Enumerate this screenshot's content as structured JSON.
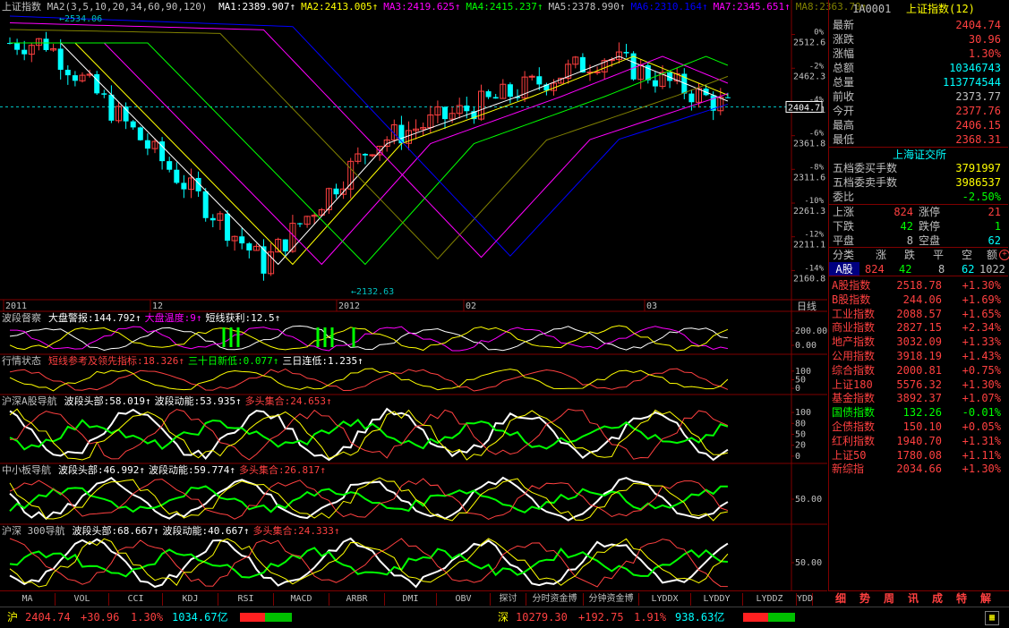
{
  "main_chart": {
    "index_name": "上证指数",
    "ma_header": "MA2(3,5,10,20,34,60,90,120)",
    "ma": [
      {
        "label": "MA1:2389.907",
        "color": "#ffffff"
      },
      {
        "label": "MA2:2413.005",
        "color": "#ffff00"
      },
      {
        "label": "MA3:2419.625",
        "color": "#ff00ff"
      },
      {
        "label": "MA4:2415.237",
        "color": "#00ff00"
      },
      {
        "label": "MA5:2378.990",
        "color": "#c0c0c0"
      },
      {
        "label": "MA6:2310.164",
        "color": "#0000ff"
      },
      {
        "label": "MA7:2345.651",
        "color": "#ff00ff"
      },
      {
        "label": "MA8:2363.70",
        "color": "#808000"
      }
    ],
    "high_label": "2534.06",
    "low_label": "2132.63",
    "current_price_tag": "2404.7",
    "price_ticks": [
      "2512.6",
      "2462.3",
      "2412.1",
      "2361.8",
      "2311.6",
      "2261.3",
      "2211.1",
      "2160.8"
    ],
    "pct_ticks": [
      "0%",
      "-2%",
      "-4%",
      "-6%",
      "-8%",
      "-10%",
      "-12%",
      "-14%"
    ],
    "date_labels": [
      "2011",
      "12",
      "2012",
      "02",
      "03"
    ],
    "period": "日线"
  },
  "panels": [
    {
      "title": "波段督察",
      "items": [
        {
          "t": "大盘警报:144.792",
          "c": "#ffffff"
        },
        {
          "t": "大盘温度:9",
          "c": "#ff00ff"
        },
        {
          "t": "短线获利:12.5",
          "c": "#ffffff"
        }
      ],
      "ticks": [
        "200.00",
        "0.00"
      ]
    },
    {
      "title": "行情状态",
      "items": [
        {
          "t": "短线参考及领先指标:18.326",
          "c": "#ff4040"
        },
        {
          "t": "三十日新低:0.077",
          "c": "#00ff00"
        },
        {
          "t": "三日连低:1.235",
          "c": "#ffffff"
        }
      ],
      "ticks": [
        "100",
        "50",
        "0"
      ]
    },
    {
      "title": "沪深A股导航",
      "items": [
        {
          "t": "波段头部:58.019",
          "c": "#ffffff"
        },
        {
          "t": "波段动能:53.935",
          "c": "#ffffff"
        },
        {
          "t": "多头集合:24.653",
          "c": "#ff4040"
        }
      ],
      "ticks": [
        "100",
        "80",
        "50",
        "20",
        "0"
      ]
    },
    {
      "title": "中小板导航",
      "items": [
        {
          "t": "波段头部:46.992",
          "c": "#ffffff"
        },
        {
          "t": "波段动能:59.774",
          "c": "#ffffff"
        },
        {
          "t": "多头集合:26.817",
          "c": "#ff4040"
        }
      ],
      "ticks": [
        "50.00"
      ]
    },
    {
      "title": "沪深 300导航",
      "items": [
        {
          "t": "波段头部:68.667",
          "c": "#ffffff"
        },
        {
          "t": "波段动能:40.667",
          "c": "#ffffff"
        },
        {
          "t": "多头集合:24.333",
          "c": "#ff4040"
        }
      ],
      "ticks": [
        "50.00"
      ]
    }
  ],
  "quote": {
    "code": "1A0001",
    "name": "上证指数(12)",
    "rows": [
      {
        "k": "最新",
        "v": "2404.74",
        "c": "#ff4040"
      },
      {
        "k": "涨跌",
        "v": "30.96",
        "c": "#ff4040"
      },
      {
        "k": "涨幅",
        "v": "1.30%",
        "c": "#ff4040"
      },
      {
        "k": "总额",
        "v": "10346743",
        "c": "#00ffff"
      },
      {
        "k": "总量",
        "v": "113774544",
        "c": "#00ffff"
      },
      {
        "k": "前收",
        "v": "2373.77",
        "c": "#c0c0c0"
      },
      {
        "k": "今开",
        "v": "2377.76",
        "c": "#ff4040"
      },
      {
        "k": "最高",
        "v": "2406.15",
        "c": "#ff4040"
      },
      {
        "k": "最低",
        "v": "2368.31",
        "c": "#ff4040"
      }
    ],
    "exchange": "上海证交所",
    "rows2": [
      {
        "k": "五档委买手数",
        "v": "3791997",
        "c": "#ffff00"
      },
      {
        "k": "五档委卖手数",
        "v": "3986537",
        "c": "#ffff00"
      },
      {
        "k": "委比",
        "v": "-2.50%",
        "c": "#00ff00"
      }
    ],
    "breadth": {
      "up_k": "上涨",
      "up_v": "824",
      "limit_up_k": "涨停",
      "limit_up_v": "21",
      "down_k": "下跌",
      "down_v": "42",
      "limit_down_k": "跌停",
      "limit_down_v": "1",
      "flat_k": "平盘",
      "flat_v": "8",
      "empty_k": "空盘",
      "empty_v": "62"
    },
    "class_header": [
      "分类",
      "涨",
      "跌",
      "平",
      "空",
      "额"
    ],
    "class_row": {
      "name": "A股",
      "up": "824",
      "down": "42",
      "flat": "8",
      "empty": "62",
      "amt": "1022"
    }
  },
  "indices": [
    {
      "n": "A股指数",
      "p": "2518.78",
      "c": "+1.30%"
    },
    {
      "n": "B股指数",
      "p": "244.06",
      "c": "+1.69%"
    },
    {
      "n": "工业指数",
      "p": "2088.57",
      "c": "+1.65%"
    },
    {
      "n": "商业指数",
      "p": "2827.15",
      "c": "+2.34%"
    },
    {
      "n": "地产指数",
      "p": "3032.09",
      "c": "+1.33%"
    },
    {
      "n": "公用指数",
      "p": "3918.19",
      "c": "+1.43%"
    },
    {
      "n": "综合指数",
      "p": "2000.81",
      "c": "+0.75%"
    },
    {
      "n": "上证180",
      "p": "5576.32",
      "c": "+1.30%"
    },
    {
      "n": "基金指数",
      "p": "3892.37",
      "c": "+1.07%"
    },
    {
      "n": "国债指数",
      "p": "132.26",
      "c": "-0.01%",
      "green": true
    },
    {
      "n": "企债指数",
      "p": "150.10",
      "c": "+0.05%"
    },
    {
      "n": "红利指数",
      "p": "1940.70",
      "c": "+1.31%"
    },
    {
      "n": "上证50",
      "p": "1780.08",
      "c": "+1.11%"
    },
    {
      "n": "新综指",
      "p": "2034.66",
      "c": "+1.30%"
    }
  ],
  "tabs": [
    "MA",
    "VOL",
    "CCI",
    "KDJ",
    "RSI",
    "MACD",
    "ARBR",
    "DMI",
    "OBV",
    "探讨",
    "分时资金博",
    "分钟资金博",
    "LYDDX",
    "LYDDY",
    "LYDDZ",
    "YDD"
  ],
  "right_tabs": [
    "细",
    "势",
    "周",
    "讯",
    "成",
    "特",
    "解"
  ],
  "status": {
    "sh_label": "沪",
    "sh_price": "2404.74",
    "sh_chg": "+30.96",
    "sh_pct": "1.30%",
    "sh_amt": "1034.67亿",
    "sz_label": "深",
    "sz_price": "10279.30",
    "sz_chg": "+192.75",
    "sz_pct": "1.91%",
    "sz_amt": "938.63亿"
  }
}
